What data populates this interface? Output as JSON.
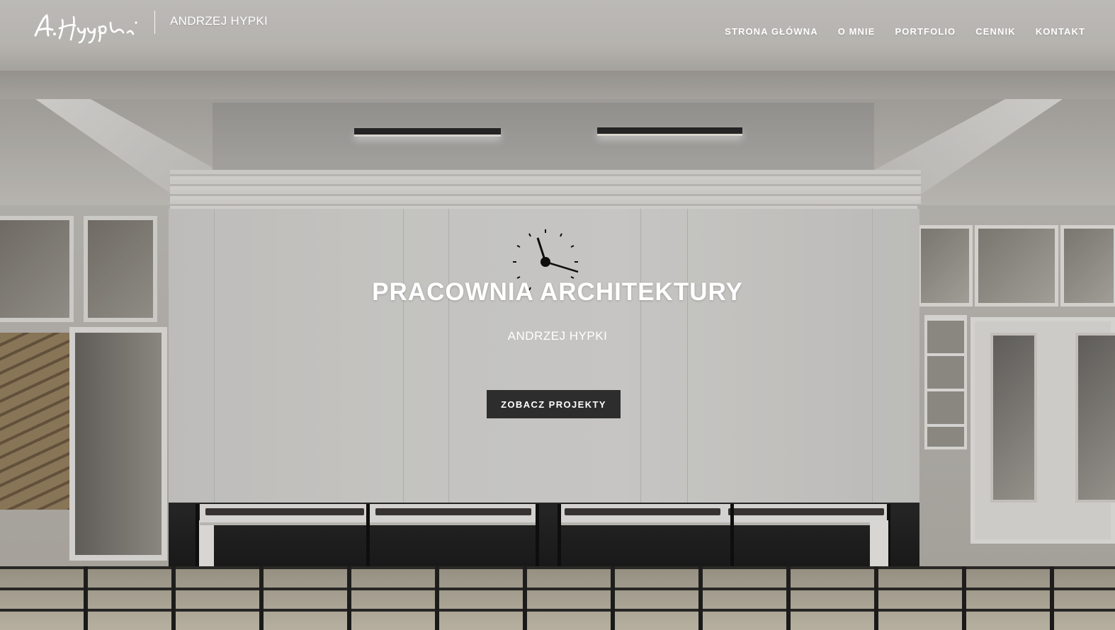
{
  "header": {
    "brand_name": "ANDRZEJ HYPKI",
    "logo_icon": "signature-logo-icon"
  },
  "nav": {
    "items": [
      {
        "label": "STRONA GŁÓWNA"
      },
      {
        "label": "O MNIE"
      },
      {
        "label": "PORTFOLIO"
      },
      {
        "label": "CENNIK"
      },
      {
        "label": "KONTAKT"
      }
    ]
  },
  "hero": {
    "title": "PRACOWNIA ARCHITEKTURY",
    "subtitle": "ANDRZEJ HYPKI",
    "cta_label": "ZOBACZ PROJEKTY",
    "background": "architecture-hall-photo"
  },
  "colors": {
    "text": "#ffffff",
    "button_bg": "#2d2d2d"
  }
}
